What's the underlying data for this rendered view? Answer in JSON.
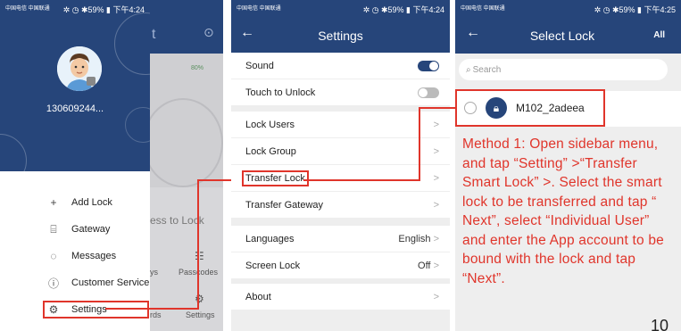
{
  "status": {
    "carrier": "中国电信 中国联通",
    "right_p1": "✲ ◷ ✱59% ▮ 下午4:24",
    "right_p2": "✲ ◷ ✱59% ▮ 下午4:24",
    "right_p3": "✲ ◷ ✱59% ▮ 下午4:25"
  },
  "panel1": {
    "phone": "130609244...",
    "menu": [
      {
        "icon": "+",
        "label": "Add Lock"
      },
      {
        "icon": "⌸",
        "label": "Gateway"
      },
      {
        "icon": "◌",
        "label": "Messages"
      },
      {
        "icon": "ⓘ",
        "label": "Customer Service"
      },
      {
        "icon": "⚙",
        "label": "Settings"
      }
    ],
    "background": {
      "t": "t",
      "battery": "80%",
      "lock_text": "ess to Lock",
      "ys": "ys",
      "passcodes": "Passcodes",
      "rds": "rds",
      "settings": "Settings"
    }
  },
  "panel2": {
    "title": "Settings",
    "back": "←",
    "rows": [
      {
        "label": "Sound",
        "toggle": "on"
      },
      {
        "label": "Touch to Unlock",
        "toggle": "off"
      },
      {
        "label": "Lock Users",
        "chev": ">"
      },
      {
        "label": "Lock Group",
        "chev": ">"
      },
      {
        "label": "Transfer Lock",
        "chev": ">"
      },
      {
        "label": "Transfer Gateway",
        "chev": ">"
      },
      {
        "label": "Languages",
        "value": "English",
        "chev": ">"
      },
      {
        "label": "Screen Lock",
        "value": "Off",
        "chev": ">"
      },
      {
        "label": "About",
        "chev": ">"
      }
    ]
  },
  "panel3": {
    "title": "Select Lock",
    "back": "←",
    "all": "All",
    "search_placeholder": "Search",
    "lock_name": "M102_2adeea",
    "method": "Method 1: Open sidebar menu, and tap “Setting” >“Transfer Smart Lock” >. Select the smart lock to be transferred and tap “ Next”, select “Individual User” and enter the App account to be bound with the lock and tap “Next”."
  },
  "page_number": "10",
  "colors": {
    "brand": "#26457a",
    "highlight": "#e0352b"
  }
}
